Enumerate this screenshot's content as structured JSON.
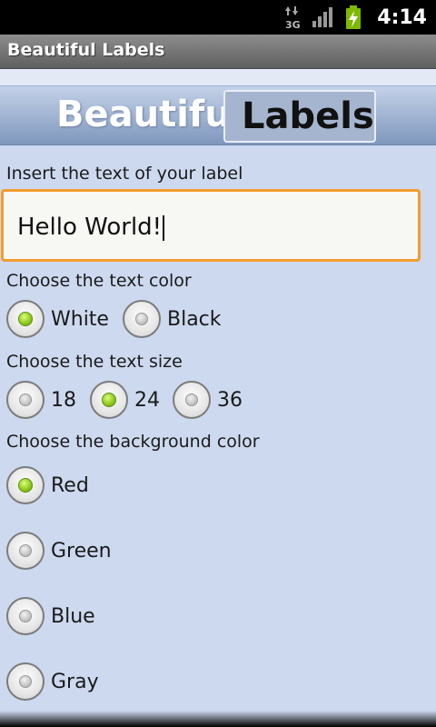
{
  "status_bar": {
    "time": "4:14",
    "network_label": "3G",
    "icons": [
      "data-arrows-icon",
      "signal-bars-icon",
      "battery-charging-icon"
    ]
  },
  "app": {
    "title": "Beautiful Labels"
  },
  "banner": {
    "word1": "Beautiful",
    "word2": "Labels"
  },
  "text_section": {
    "label": "Insert the text of your label",
    "value": "Hello World!"
  },
  "text_color": {
    "label": "Choose the text color",
    "options": [
      {
        "label": "White",
        "checked": true
      },
      {
        "label": "Black",
        "checked": false
      }
    ]
  },
  "text_size": {
    "label": "Choose the text size",
    "options": [
      {
        "label": "18",
        "checked": false
      },
      {
        "label": "24",
        "checked": true
      },
      {
        "label": "36",
        "checked": false
      }
    ]
  },
  "background_color": {
    "label": "Choose the background color",
    "options": [
      {
        "label": "Red",
        "checked": true
      },
      {
        "label": "Green",
        "checked": false
      },
      {
        "label": "Blue",
        "checked": false
      },
      {
        "label": "Gray",
        "checked": false
      }
    ]
  },
  "colors": {
    "background": "#cdd9ef",
    "focus_border": "#f39c2c",
    "radio_checked": "#8cc51a"
  }
}
